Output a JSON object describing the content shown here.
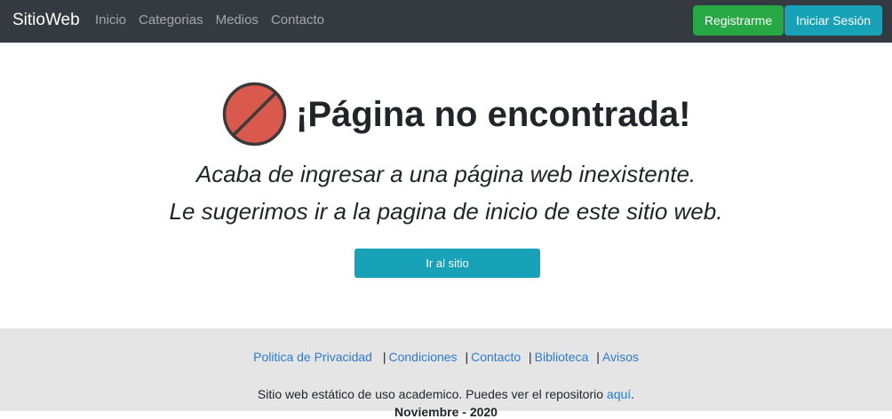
{
  "navbar": {
    "brand": "SitioWeb",
    "links": [
      "Inicio",
      "Categorias",
      "Medios",
      "Contacto"
    ],
    "register_label": "Registrarme",
    "login_label": "Iniciar Sesión",
    "colors": {
      "bg": "#343a40",
      "register": "#28a745",
      "login": "#17a2b8"
    }
  },
  "main": {
    "icon": "no-entry-icon",
    "title": "¡Página no encontrada!",
    "subtitle_line1": "Acaba de ingresar a una página web inexistente.",
    "subtitle_line2": "Le sugerimos ir a la pagina de inicio de este sitio web.",
    "go_button_label": "Ir al sitio",
    "icon_color": "#d9594c"
  },
  "footer": {
    "links": [
      "Politica de Privacidad",
      "Condiciones",
      "Contacto",
      "Biblioteca",
      "Avisos"
    ],
    "separator": "|",
    "text_prefix": "Sitio web estático de uso academico. Puedes ver el repositorio ",
    "text_link": "aquí",
    "text_suffix": ".",
    "date": "Noviembre - 2020"
  }
}
